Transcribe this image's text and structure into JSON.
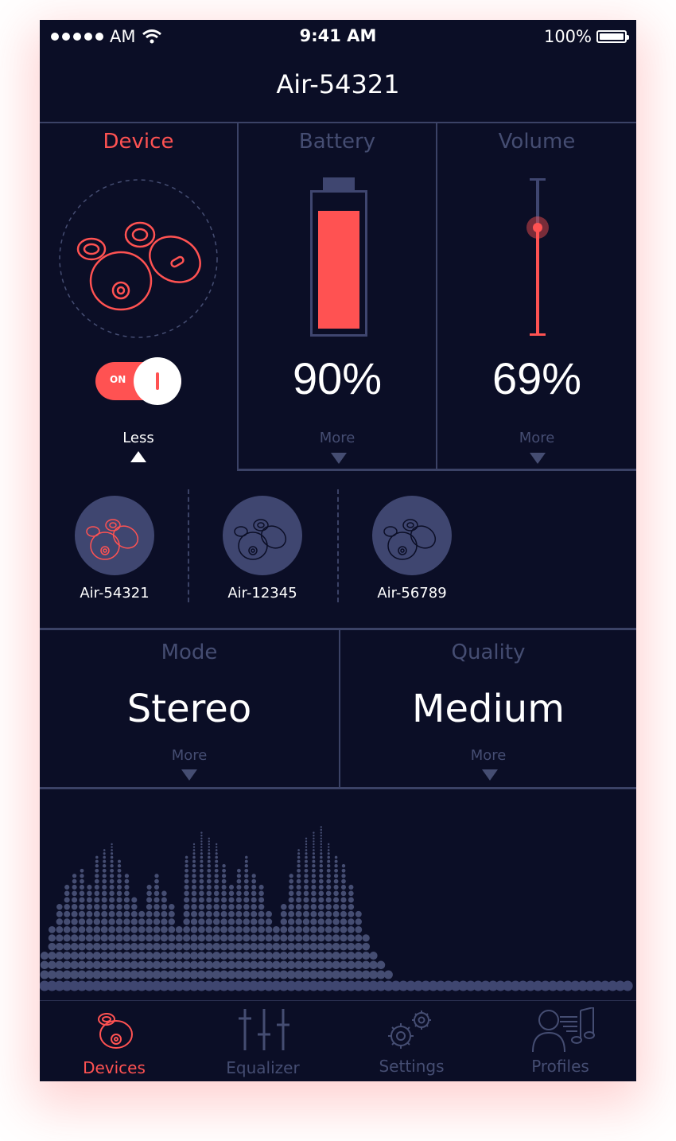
{
  "status": {
    "carrier_time_suffix": "AM",
    "time": "9:41 AM",
    "battery_text": "100%"
  },
  "header": {
    "title": "Air-54321"
  },
  "device": {
    "label": "Device",
    "toggle_text": "ON",
    "less_label": "Less"
  },
  "battery": {
    "label": "Battery",
    "value_text": "90%",
    "level": 0.9,
    "more_label": "More"
  },
  "volume": {
    "label": "Volume",
    "value_text": "69%",
    "level": 0.69,
    "more_label": "More"
  },
  "devices": [
    {
      "name": "Air-54321",
      "selected": true
    },
    {
      "name": "Air-12345",
      "selected": false
    },
    {
      "name": "Air-56789",
      "selected": false
    }
  ],
  "mode": {
    "label": "Mode",
    "value": "Stereo",
    "more_label": "More"
  },
  "quality": {
    "label": "Quality",
    "value": "Medium",
    "more_label": "More"
  },
  "tabs": [
    {
      "label": "Devices",
      "icon": "earbud-icon",
      "active": true
    },
    {
      "label": "Equalizer",
      "icon": "sliders-icon",
      "active": false
    },
    {
      "label": "Settings",
      "icon": "gears-icon",
      "active": false
    },
    {
      "label": "Profiles",
      "icon": "profile-music-icon",
      "active": false
    }
  ],
  "colors": {
    "accent": "#ff5252",
    "background": "#0b0e26",
    "muted": "#454d72",
    "divider": "#3b4266"
  }
}
